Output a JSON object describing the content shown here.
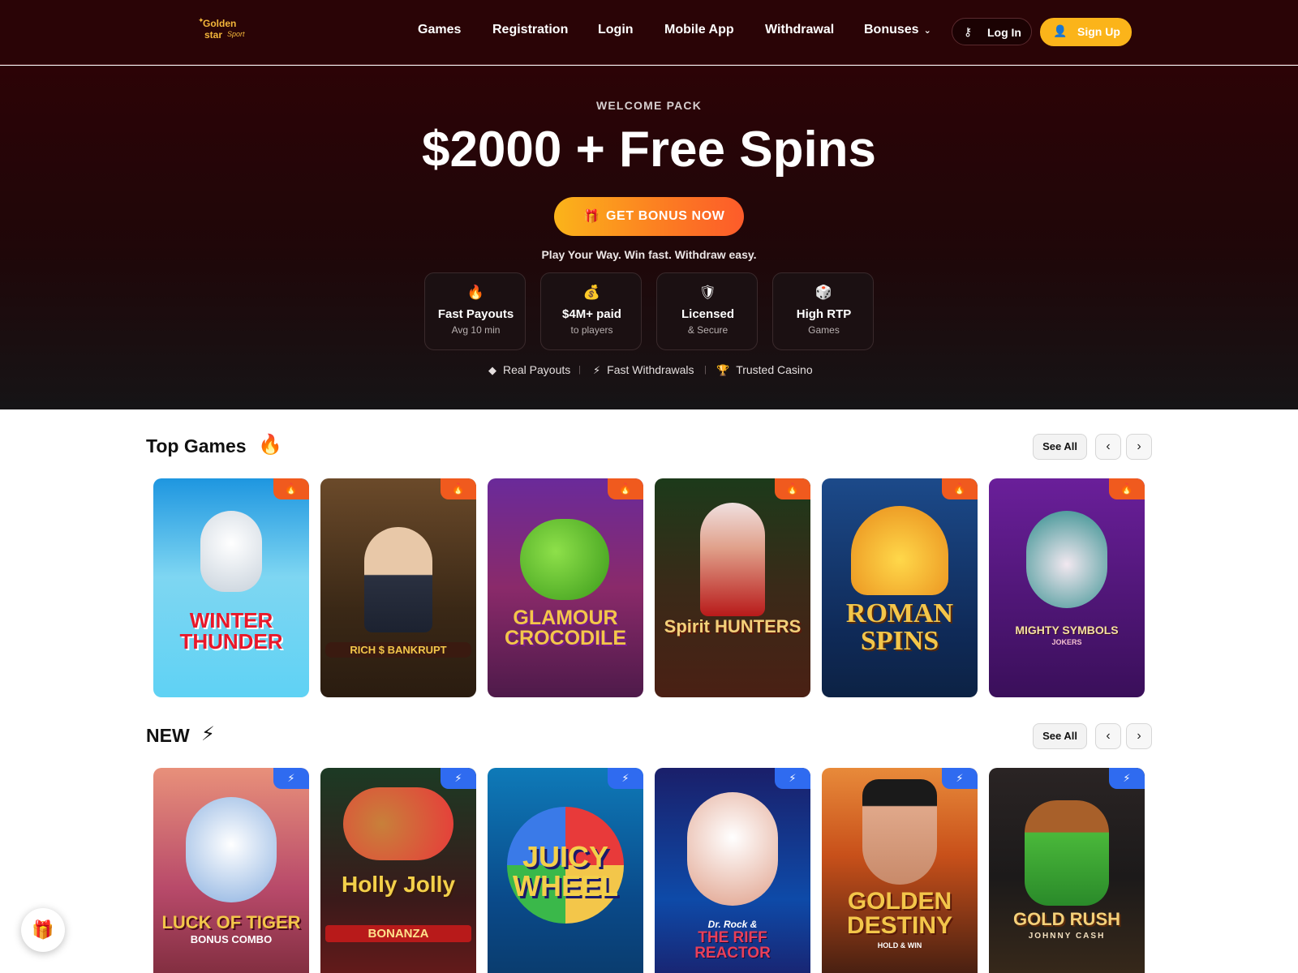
{
  "header": {
    "logo": {
      "line1": "Golden",
      "line2": "star",
      "line3": "Sport"
    },
    "nav": [
      "Games",
      "Registration",
      "Login",
      "Mobile App",
      "Withdrawal",
      "Bonuses"
    ],
    "login_label": "Log In",
    "signup_label": "Sign Up"
  },
  "hero": {
    "kicker": "WELCOME PACK",
    "headline": "$2000 + Free Spins",
    "cta_label": "GET BONUS NOW",
    "tagline": "Play Your Way. Win fast. Withdraw easy.",
    "features": [
      {
        "icon": "flame-icon",
        "title": "Fast Payouts",
        "subtitle": "Avg 10 min"
      },
      {
        "icon": "money-bag-icon",
        "title": "$4M+ paid",
        "subtitle": "to players"
      },
      {
        "icon": "shield-icon",
        "title": "Licensed",
        "subtitle": "& Secure"
      },
      {
        "icon": "dice-icon",
        "title": "High RTP",
        "subtitle": "Games"
      }
    ],
    "trust": [
      {
        "icon": "diamond-icon",
        "label": "Real Payouts"
      },
      {
        "icon": "bolt-icon",
        "label": "Fast Withdrawals"
      },
      {
        "icon": "trophy-icon",
        "label": "Trusted Casino"
      }
    ]
  },
  "sections": {
    "top": {
      "title": "Top Games",
      "icon": "flame-icon",
      "see_all": "See All",
      "games": [
        {
          "title": "WINTER THUNDER",
          "colors": [
            "#1e96e0",
            "#5fd2f4"
          ]
        },
        {
          "title": "RICH $ BANKRUPT",
          "colors": [
            "#3a2816",
            "#6b4a2a"
          ]
        },
        {
          "title": "GLAMOUR CROCODILE",
          "colors": [
            "#4e1a4a",
            "#8a2a6a"
          ]
        },
        {
          "title": "Spirit HUNTERS",
          "colors": [
            "#1c3a1a",
            "#4a2014"
          ]
        },
        {
          "title": "ROMAN SPINS",
          "colors": [
            "#0f2a58",
            "#1c4a8a"
          ]
        },
        {
          "title": "MIGHTY SYMBOLS",
          "subtitle": "JOKERS",
          "colors": [
            "#3a0f5a",
            "#6a1f9a"
          ]
        }
      ]
    },
    "new": {
      "title": "NEW",
      "icon": "bolt-icon",
      "see_all": "See All",
      "games": [
        {
          "title": "LUCK OF TIGER",
          "subtitle": "BONUS COMBO",
          "colors": [
            "#e8907a",
            "#7a2a3a"
          ]
        },
        {
          "title": "Holly Jolly",
          "subtitle": "BONANZA",
          "colors": [
            "#1c3a24",
            "#6a1a1a"
          ]
        },
        {
          "title": "JUICY WHEEL",
          "colors": [
            "#0e7ab8",
            "#0a3a6a"
          ]
        },
        {
          "title": "THE RIFF REACTOR",
          "subtitle": "Dr. Rock &",
          "colors": [
            "#1a1f6a",
            "#0e4aa8"
          ]
        },
        {
          "title": "GOLDEN DESTINY",
          "subtitle": "HOLD & WIN",
          "colors": [
            "#c8501a",
            "#3a1a10"
          ]
        },
        {
          "title": "GOLD RUSH",
          "subtitle": "JOHNNY CASH",
          "colors": [
            "#1c1a1a",
            "#3a2a1a"
          ]
        }
      ]
    }
  },
  "colors": {
    "header_bg": "#2a0406",
    "accent": "#fbb41a",
    "cta_end": "#fd5b2a",
    "hot_badge": "#f05a1e",
    "new_badge": "#2f6bf0"
  }
}
